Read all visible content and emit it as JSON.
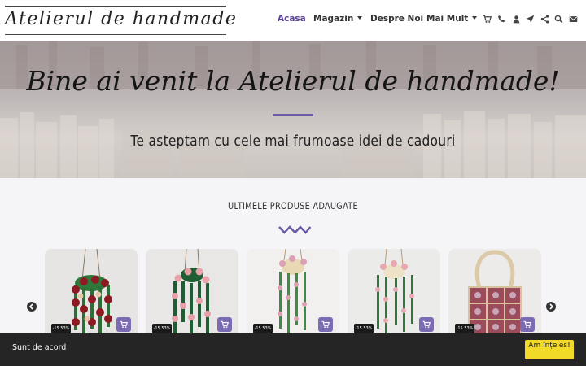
{
  "header": {
    "logo_text": "Atelierul de handmade",
    "nav": [
      {
        "label": "Acasă",
        "active": true,
        "dropdown": false
      },
      {
        "label": "Magazin",
        "active": false,
        "dropdown": true
      },
      {
        "label": "Despre Noi",
        "active": false,
        "dropdown": false
      },
      {
        "label": "Mai Mult",
        "active": false,
        "dropdown": true
      }
    ],
    "icons": [
      "cart-icon",
      "phone-icon",
      "user-icon",
      "location-icon",
      "share-icon",
      "search-icon",
      "mail-icon"
    ],
    "accent_color": "#5a3f99"
  },
  "hero": {
    "title": "Bine ai venit la Atelierul de handmade!",
    "subtitle": "Te asteptam cu cele mai frumoase idei de cadouri",
    "divider_color": "#6a5aa5"
  },
  "products_section": {
    "title": "ULTIMELE PRODUSE ADAUGATE",
    "products": [
      {
        "discount": "-15.53%",
        "image": "hanging-plant-red-roses"
      },
      {
        "discount": "-15.53%",
        "image": "hanging-plant-pink-roses"
      },
      {
        "discount": "-15.53%",
        "image": "hanging-plant-light-pink"
      },
      {
        "discount": "-15.53%",
        "image": "hanging-plant-rose-string"
      },
      {
        "discount": "-15.53%",
        "image": "crochet-granny-square-bag"
      }
    ],
    "cart_button_color": "#7b6bb3"
  },
  "cookie_bar": {
    "text": "Sunt de acord",
    "button_label": "Am înțeles!",
    "button_color": "#f2da28"
  }
}
